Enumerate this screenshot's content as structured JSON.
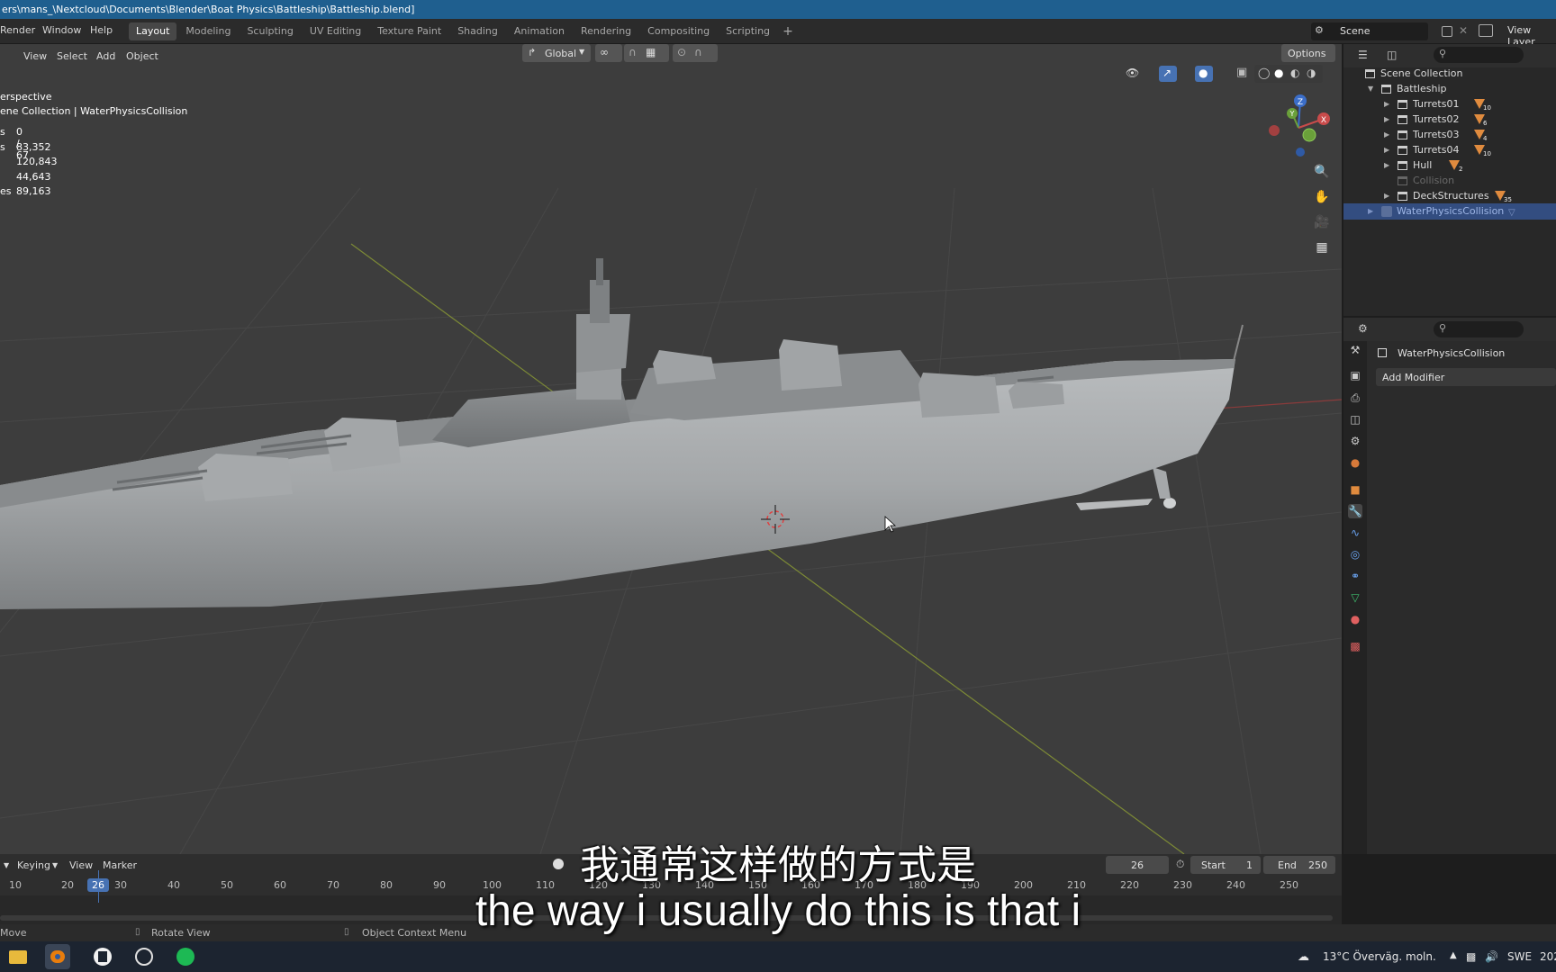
{
  "window": {
    "title": "ers\\mans_\\Nextcloud\\Documents\\Blender\\Boat Physics\\Battleship\\Battleship.blend]"
  },
  "menubar": {
    "items": [
      "Render",
      "Window",
      "Help"
    ],
    "workspaces": [
      {
        "label": "Layout",
        "active": true
      },
      {
        "label": "Modeling",
        "active": false
      },
      {
        "label": "Sculpting",
        "active": false
      },
      {
        "label": "UV Editing",
        "active": false
      },
      {
        "label": "Texture Paint",
        "active": false
      },
      {
        "label": "Shading",
        "active": false
      },
      {
        "label": "Animation",
        "active": false
      },
      {
        "label": "Rendering",
        "active": false
      },
      {
        "label": "Compositing",
        "active": false
      },
      {
        "label": "Scripting",
        "active": false
      }
    ],
    "add_workspace": "+",
    "scene": "Scene",
    "view_layer": "View Layer"
  },
  "viewport": {
    "menu": [
      "View",
      "Select",
      "Add",
      "Object"
    ],
    "transform_orientation": "Global",
    "options_label": "Options",
    "overlay": {
      "view_name": "erspective",
      "collection": "ene Collection | WaterPhysicsCollision"
    },
    "stats": [
      {
        "key": "s",
        "value": "0 / 67"
      },
      {
        "key": "s",
        "value": "83,352"
      },
      {
        "key": "",
        "value": "120,843"
      },
      {
        "key": "",
        "value": "44,643"
      },
      {
        "key": "es",
        "value": "89,163"
      }
    ],
    "gizmo": {
      "z": "Z",
      "y": "Y",
      "x": "X"
    }
  },
  "outliner": {
    "root": "Scene Collection",
    "items": [
      {
        "label": "Battleship",
        "depth": 1,
        "count": "",
        "selected": false,
        "dim": false
      },
      {
        "label": "Turrets01",
        "depth": 2,
        "count": "10",
        "selected": false,
        "dim": false
      },
      {
        "label": "Turrets02",
        "depth": 2,
        "count": "6",
        "selected": false,
        "dim": false
      },
      {
        "label": "Turrets03",
        "depth": 2,
        "count": "4",
        "selected": false,
        "dim": false
      },
      {
        "label": "Turrets04",
        "depth": 2,
        "count": "10",
        "selected": false,
        "dim": false
      },
      {
        "label": "Hull",
        "depth": 2,
        "count": "2",
        "selected": false,
        "dim": false
      },
      {
        "label": "Collision",
        "depth": 2,
        "count": "",
        "selected": false,
        "dim": true
      },
      {
        "label": "DeckStructures",
        "depth": 2,
        "count": "35",
        "selected": false,
        "dim": false
      },
      {
        "label": "WaterPhysicsCollision",
        "depth": 1,
        "count": "",
        "selected": true,
        "dim": false
      }
    ]
  },
  "properties": {
    "object_name": "WaterPhysicsCollision",
    "add_modifier": "Add Modifier"
  },
  "timeline": {
    "menu": [
      "Keying",
      "View",
      "Marker"
    ],
    "current_frame": "26",
    "start_label": "Start",
    "start": "1",
    "end_label": "End",
    "end": "250",
    "ticks": [
      "10",
      "20",
      "30",
      "40",
      "50",
      "60",
      "70",
      "80",
      "90",
      "100",
      "110",
      "120",
      "130",
      "140",
      "150",
      "160",
      "170",
      "180",
      "190",
      "200",
      "210",
      "220",
      "230",
      "240",
      "250"
    ],
    "playhead": "26"
  },
  "statusbar": {
    "move": "Move",
    "rotate": "Rotate View",
    "context": "Object Context Menu"
  },
  "taskbar": {
    "weather": "13°C  Överväg. moln.",
    "lang": "SWE",
    "year": "202"
  },
  "subtitles": {
    "zh": "我通常这样做的方式是",
    "en": "the way i usually do this is that i"
  }
}
